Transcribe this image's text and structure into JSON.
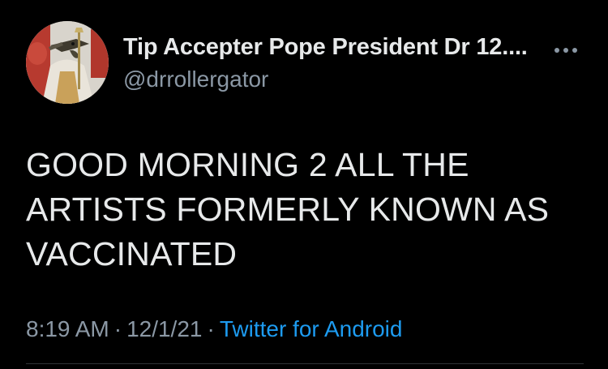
{
  "user": {
    "display_name": "Tip Accepter Pope President Dr 12....",
    "handle": "@drrollergator",
    "avatar_icon": "profile-avatar"
  },
  "actions": {
    "more_icon": "more-dots-icon"
  },
  "tweet": {
    "text_lines": [
      "GOOD MORNING 2 ALL THE",
      "ARTISTS FORMERLY KNOWN AS",
      "VACCINATED"
    ],
    "time": "8:19 AM",
    "date": "12/1/21",
    "separator": "·",
    "source": "Twitter for Android"
  },
  "colors": {
    "background": "#000000",
    "text": "#e7e9ea",
    "secondary_text": "#8b98a5",
    "link": "#1d9bf0",
    "divider": "#2f3336"
  }
}
